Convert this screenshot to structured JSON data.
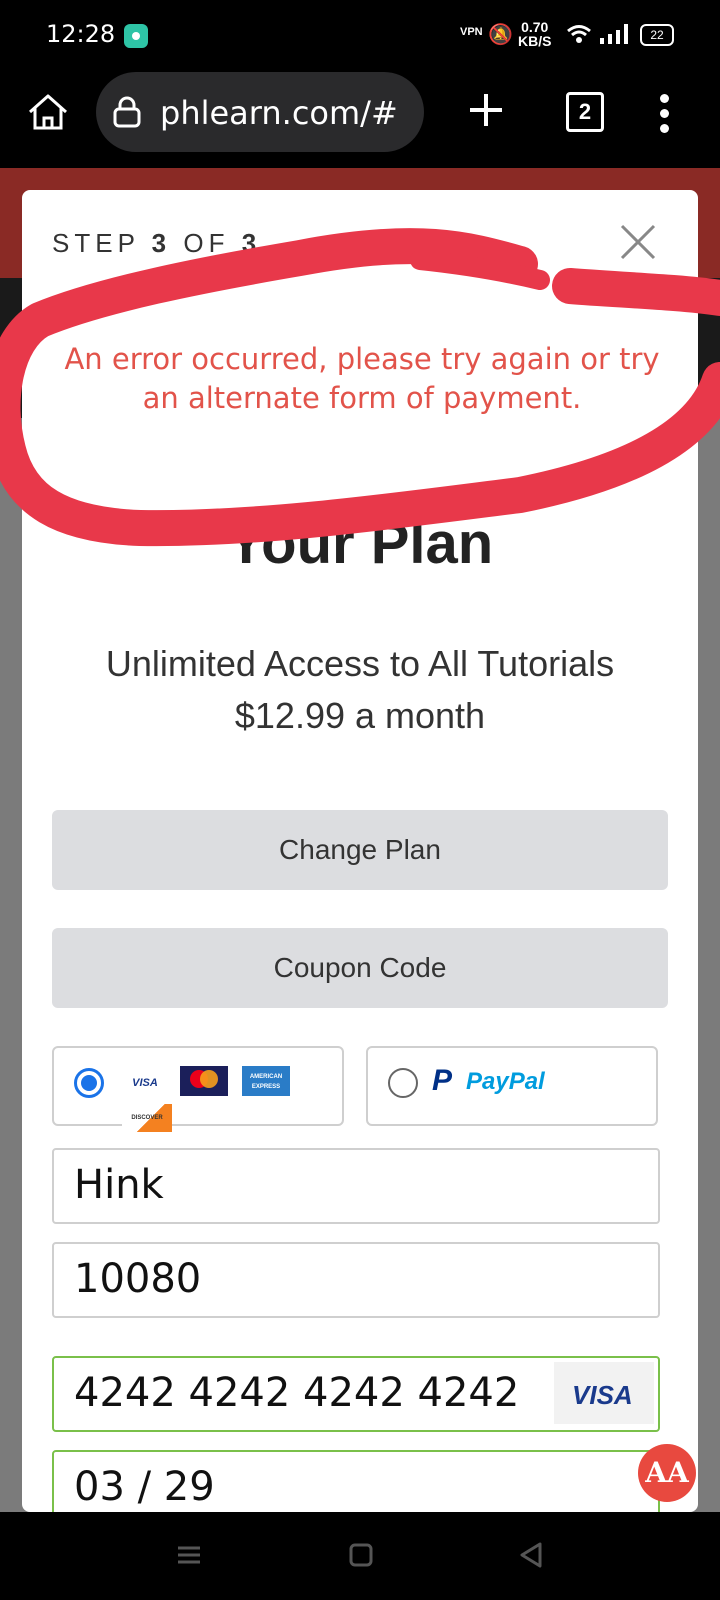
{
  "status_bar": {
    "time": "12:28",
    "vpn_label": "VPN",
    "speed_value": "0.70",
    "speed_unit": "KB/S",
    "battery": "22"
  },
  "browser": {
    "url": "phlearn.com/#",
    "tab_count": "2"
  },
  "modal": {
    "step_prefix": "STEP ",
    "step_current": "3",
    "step_mid": " OF ",
    "step_total": "3",
    "error_message": "An error occurred, please try again or try an alternate form of payment.",
    "plan_title": "Your Plan",
    "plan_description_line1": "Unlimited Access to All Tutorials",
    "plan_description_line2": "$12.99 a month",
    "change_plan_label": "Change Plan",
    "coupon_code_label": "Coupon Code",
    "payment_options": {
      "card_logos": [
        "VISA",
        "MasterCard",
        "AMERICAN EXPRESS",
        "DISCOVER"
      ],
      "card_selected": true,
      "paypal_label": "PayPal",
      "paypal_selected": false
    },
    "fields": {
      "name_value": "Hink",
      "zip_value": "10080",
      "card_number_value": "4242 4242 4242 4242",
      "card_brand": "VISA",
      "expiry_value": "03 / 29"
    }
  },
  "floating_button": {
    "label": "AA"
  },
  "colors": {
    "error_text": "#e2534a",
    "annotation_red": "#e8384a",
    "radio_selected": "#1a73e8",
    "valid_border": "#7ac04a",
    "floating_button": "#e8493f"
  },
  "icons": [
    "home-icon",
    "lock-icon",
    "plus-icon",
    "tabs-icon",
    "more-menu-icon",
    "close-icon",
    "menu-icon",
    "home-square-icon",
    "back-icon"
  ]
}
